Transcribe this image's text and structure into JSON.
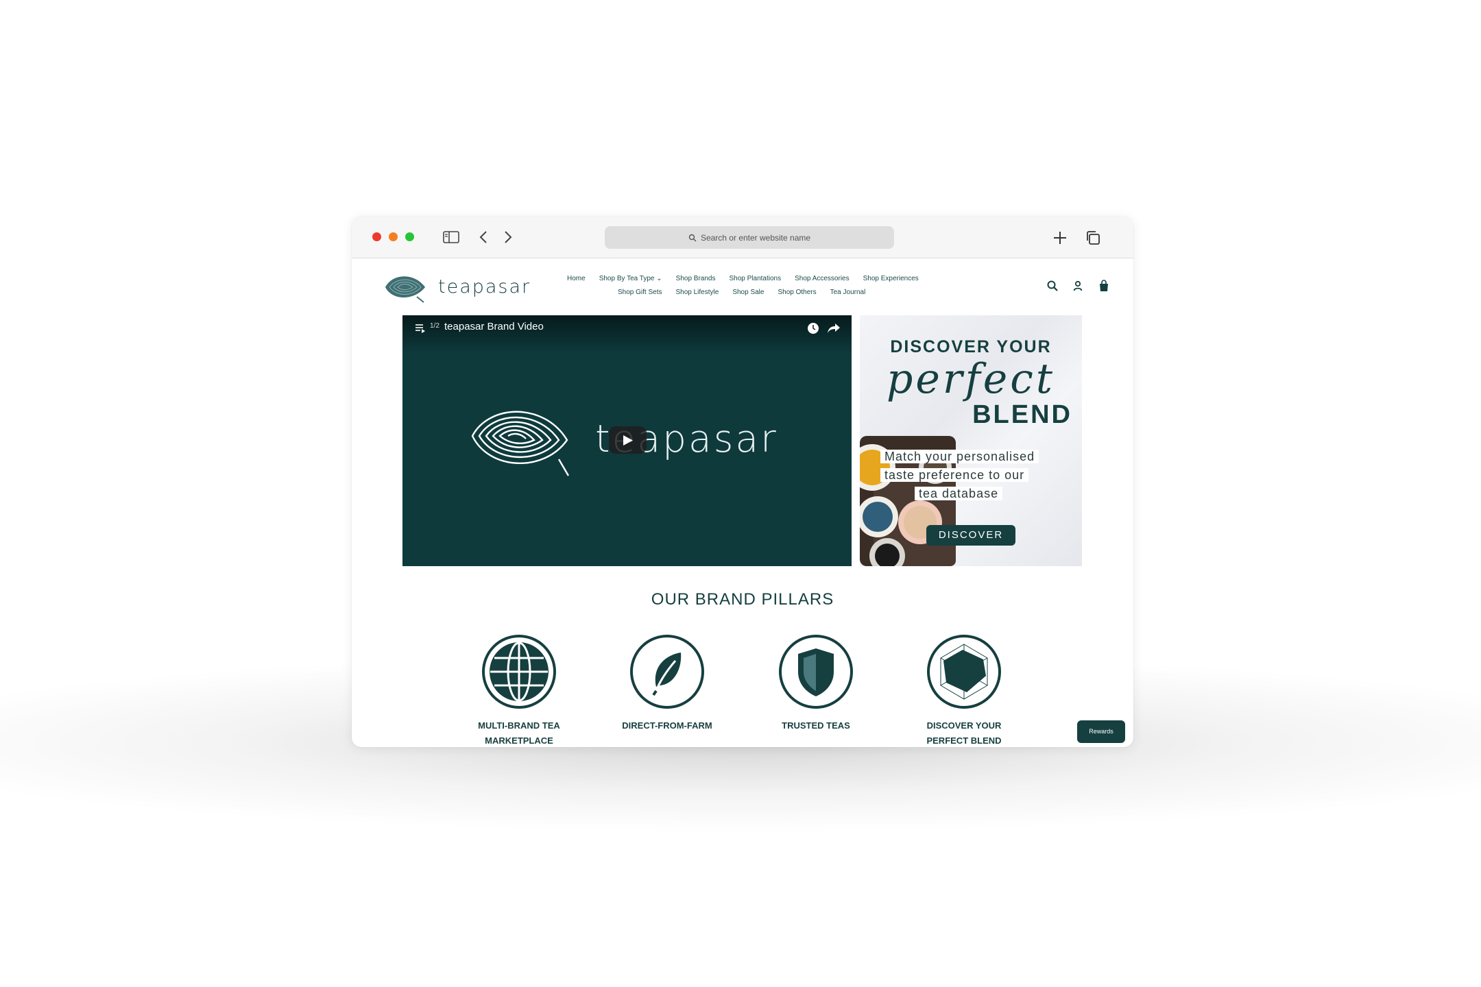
{
  "browser": {
    "address_placeholder": "Search or enter website name"
  },
  "site": {
    "logo_text": "teapasar",
    "nav_row1": [
      "Home",
      "Shop By Tea Type ⌄",
      "Shop Brands",
      "Shop Plantations",
      "Shop Accessories",
      "Shop Experiences"
    ],
    "nav_row2": [
      "Shop Gift Sets",
      "Shop Lifestyle",
      "Shop Sale",
      "Shop Others",
      "Tea Journal"
    ]
  },
  "video": {
    "count": "1/2",
    "title": "teapasar Brand Video",
    "wordmark": "teapasar"
  },
  "promo": {
    "heading_top": "DISCOVER YOUR",
    "heading_script": "perfect",
    "heading_bottom": "BLEND",
    "line1": "Match your personalised",
    "line2": "taste preference to our",
    "line3": "tea database",
    "button": "DISCOVER"
  },
  "pillars": {
    "title": "OUR BRAND PILLARS",
    "items": [
      {
        "label_line1": "MULTI-BRAND TEA",
        "label_line2": "MARKETPLACE"
      },
      {
        "label_line1": "DIRECT-FROM-FARM",
        "label_line2": ""
      },
      {
        "label_line1": "TRUSTED TEAS",
        "label_line2": ""
      },
      {
        "label_line1": "DISCOVER YOUR",
        "label_line2": "PERFECT BLEND"
      }
    ]
  },
  "rewards_label": "Rewards",
  "colors": {
    "brand": "#163f40",
    "video_bg": "#0e3a3c"
  }
}
